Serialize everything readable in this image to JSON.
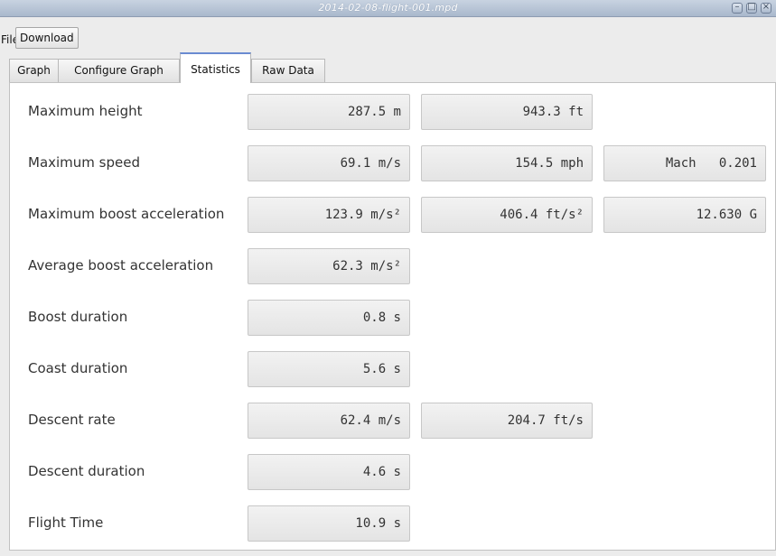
{
  "window": {
    "title": "2014-02-08-flight-001.mpd",
    "controls": [
      "minimize-icon",
      "maximize-icon",
      "close-icon"
    ]
  },
  "menu": {
    "file": "File",
    "download": "Download"
  },
  "tabs": [
    {
      "label": "Graph",
      "active": false
    },
    {
      "label": "Configure Graph",
      "active": false
    },
    {
      "label": "Statistics",
      "active": true
    },
    {
      "label": "Raw Data",
      "active": false
    }
  ],
  "stats": [
    {
      "label": "Maximum height",
      "values": [
        "287.5 m",
        "943.3 ft"
      ]
    },
    {
      "label": "Maximum speed",
      "values": [
        "69.1 m/s",
        "154.5 mph",
        "Mach   0.201"
      ]
    },
    {
      "label": "Maximum boost acceleration",
      "values": [
        "123.9 m/s²",
        "406.4 ft/s²",
        "12.630 G"
      ]
    },
    {
      "label": "Average boost acceleration",
      "values": [
        "62.3 m/s²"
      ]
    },
    {
      "label": "Boost duration",
      "values": [
        "0.8 s"
      ]
    },
    {
      "label": "Coast duration",
      "values": [
        "5.6 s"
      ]
    },
    {
      "label": "Descent rate",
      "values": [
        "62.4 m/s",
        "204.7 ft/s"
      ]
    },
    {
      "label": "Descent duration",
      "values": [
        "4.6 s"
      ]
    },
    {
      "label": "Flight Time",
      "values": [
        "10.9 s"
      ]
    }
  ],
  "colors": {
    "titlebar": "#a9b8cc",
    "active_tab_accent": "#6a8bd1",
    "field_background": "#e9e9e9"
  }
}
